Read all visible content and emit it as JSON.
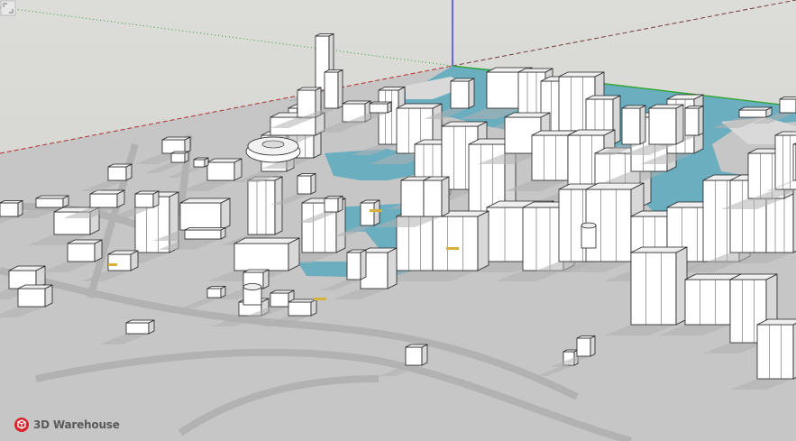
{
  "viewer": {
    "brand_label": "3D Warehouse",
    "brand_icon": "3d-warehouse-logo-icon",
    "corner_icon": "expand-corner-icon"
  },
  "colors": {
    "sky": "#d6d6d2",
    "ground": "#c4c4c4",
    "water": "#6aaec0",
    "building_face": "#ffffff",
    "building_side": "#d9d9d9",
    "building_edge": "#222222",
    "axis_blue": "#2a2ad8",
    "axis_red": "#c03030",
    "axis_green": "#2aa52a",
    "brand_red": "#d8262e"
  }
}
